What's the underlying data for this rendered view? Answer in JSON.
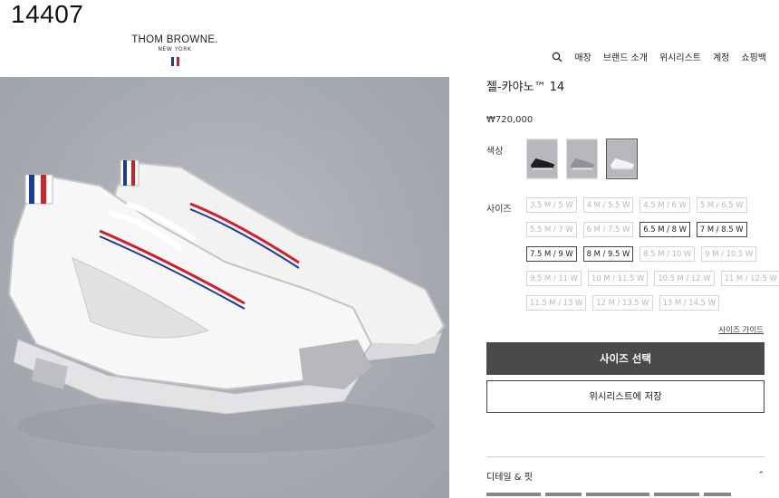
{
  "overlay": {
    "id_text": "14407"
  },
  "brand": {
    "name": "THOM BROWNE.",
    "sub": "NEW YORK",
    "flag_colors": [
      "#1f3a93",
      "#ffffff",
      "#d0202a"
    ]
  },
  "nav": {
    "search_icon": "search-icon",
    "items": [
      "매장",
      "브랜드 소개",
      "위시리스트",
      "계정",
      "쇼핑백"
    ]
  },
  "product": {
    "title": "젤-카야노™ 14",
    "price": "₩720,000",
    "color_label": "색상",
    "size_label": "사이즈",
    "swatches": [
      "black",
      "silver",
      "white"
    ],
    "selected_swatch": "white",
    "size_rows": [
      [
        {
          "label": "3.5 M / 5 W",
          "available": false
        },
        {
          "label": "4 M / 5.5 W",
          "available": false
        },
        {
          "label": "4.5 M / 6 W",
          "available": false
        },
        {
          "label": "5 M / 6.5 W",
          "available": false
        }
      ],
      [
        {
          "label": "5.5 M / 7 W",
          "available": false
        },
        {
          "label": "6 M / 7.5 W",
          "available": false
        },
        {
          "label": "6.5 M / 8 W",
          "available": true
        },
        {
          "label": "7 M / 8.5 W",
          "available": true
        }
      ],
      [
        {
          "label": "7.5 M / 9 W",
          "available": true
        },
        {
          "label": "8 M / 9.5 W",
          "available": true
        },
        {
          "label": "8.5 M / 10 W",
          "available": false
        },
        {
          "label": "9 M / 10.5 W",
          "available": false
        }
      ],
      [
        {
          "label": "9.5 M / 11 W",
          "available": false
        },
        {
          "label": "10 M / 11.5 W",
          "available": false
        },
        {
          "label": "10.5 M / 12 W",
          "available": false
        },
        {
          "label": "11 M / 12.5 W",
          "available": false
        }
      ],
      [
        {
          "label": "11.5 M / 13 W",
          "available": false
        },
        {
          "label": "12 M / 13.5 W",
          "available": false
        },
        {
          "label": "13 M / 14.5 W",
          "available": false
        }
      ]
    ],
    "size_guide": "사이즈 가이드",
    "select_size_button": "사이즈 선택",
    "wishlist_button": "위시리스트에 저장",
    "details_label": "디테일 & 핏"
  }
}
